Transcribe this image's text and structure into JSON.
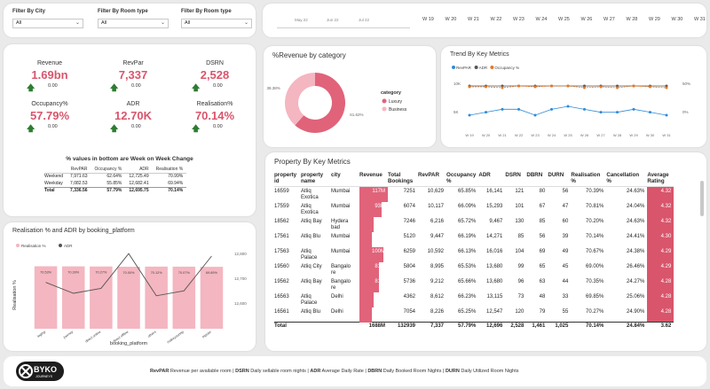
{
  "filters": [
    {
      "label": "Filter By City",
      "value": "All"
    },
    {
      "label": "Filter By Room type",
      "value": "All"
    },
    {
      "label": "Filter By Room type",
      "value": "All"
    }
  ],
  "weeks": {
    "dates": [
      "May 22",
      "Jun 22",
      "Jul 22"
    ],
    "labels": [
      "W 19",
      "W 20",
      "W 21",
      "W 22",
      "W 23",
      "W 24",
      "W 25",
      "W 26",
      "W 27",
      "W 28",
      "W 29",
      "W 30",
      "W 31"
    ]
  },
  "kpis": [
    {
      "title": "Revenue",
      "value": "1.69bn",
      "delta": "0.00"
    },
    {
      "title": "RevPar",
      "value": "7,337",
      "delta": "0.00"
    },
    {
      "title": "DSRN",
      "value": "2,528",
      "delta": "0.00"
    },
    {
      "title": "Occupancy%",
      "value": "57.79%",
      "delta": "0.00"
    },
    {
      "title": "ADR",
      "value": "12.70K",
      "delta": "0.00"
    },
    {
      "title": "Realisation%",
      "value": "70.14%",
      "delta": "0.00"
    }
  ],
  "wow": {
    "title": "% values in bottom are Week on Week Change",
    "headers": [
      "",
      "RevPAR",
      "Occupancy %",
      "ADR",
      "Realisation %"
    ],
    "rows": [
      [
        "Weekend",
        "7,971.63",
        "62.64%",
        "12,725.49",
        "70.99%"
      ],
      [
        "Weekday",
        "7,082.53",
        "55.85%",
        "12,682.41",
        "69.94%"
      ],
      [
        "Total",
        "7,336.56",
        "57.79%",
        "12,695.75",
        "70.14%"
      ]
    ]
  },
  "donut_title": "%Revenue by category",
  "trend_title": "Trend By Key Metrics",
  "realis_title": "Realisation % and ADR by booking_platform",
  "prop_title": "Property By Key Metrics",
  "chart_data": [
    {
      "type": "pie",
      "title": "%Revenue by category",
      "legend_title": "category",
      "categories": [
        "Luxury",
        "Business"
      ],
      "values": [
        61.62,
        38.38
      ],
      "value_labels": [
        "61.62%",
        "38.38%"
      ],
      "colors": [
        "#e0637a",
        "#f4b6c0"
      ]
    },
    {
      "type": "line",
      "title": "Trend By Key Metrics",
      "series": [
        {
          "name": "RevPAR",
          "color": "#2e8bd8",
          "values": [
            7.0,
            7.1,
            7.2,
            7.2,
            7.0,
            7.2,
            7.3,
            7.2,
            7.1,
            7.1,
            7.2,
            7.1,
            7.0,
            7.2
          ]
        },
        {
          "name": "ADR",
          "color": "#555555",
          "values": [
            12.7,
            12.7,
            12.7,
            12.7,
            12.7,
            12.7,
            12.7,
            12.7,
            12.7,
            12.7,
            12.7,
            12.7,
            12.7,
            12.7
          ]
        },
        {
          "name": "Occupancy %",
          "color": "#e87722",
          "values": [
            58,
            58,
            57,
            59,
            58,
            59,
            59,
            57,
            58,
            57,
            59,
            58,
            57,
            58
          ]
        }
      ],
      "categories": [
        "W 19",
        "W 20",
        "W 21",
        "W 22",
        "W 23",
        "W 24",
        "W 25",
        "W 26",
        "W 27",
        "W 28",
        "W 29",
        "W 30",
        "W 31"
      ],
      "y_ticks_left": [
        "10K",
        "5K"
      ],
      "y_ticks_right": [
        "50%",
        "0%"
      ]
    },
    {
      "type": "bar",
      "title": "Realisation % and ADR by booking_platform",
      "xlabel": "booking_platform",
      "ylabel": "Realisation %",
      "categories": [
        "logtrip",
        "journey",
        "direct online",
        "direct offline",
        "others",
        "makeyourtrip",
        "tripster"
      ],
      "series": [
        {
          "name": "Realisation %",
          "color": "#f4b6c0",
          "values": [
            70.53,
            70.39,
            70.27,
            70.0,
            70.12,
            70.07,
            69.89
          ]
        },
        {
          "name": "ADR",
          "color": "#555555",
          "values": [
            12694,
            12650,
            12670,
            12810,
            12640,
            12660,
            12800
          ]
        }
      ],
      "value_labels": [
        "70.53%",
        "70.39%",
        "70.27%",
        "70.00%",
        "70.12%",
        "70.07%",
        "69.89%"
      ],
      "y2_ticks": [
        "12,800",
        "12,700",
        "12,600"
      ]
    }
  ],
  "prop_table": {
    "headers": [
      "property id",
      "property name",
      "city",
      "Revenue",
      "Total Bookings",
      "RevPAR",
      "Occupancy %",
      "ADR",
      "DSRN",
      "DBRN",
      "DURN",
      "Realisation %",
      "Cancellation %",
      "Average Rating"
    ],
    "rows": [
      [
        "16559",
        "Atliq Exotica",
        "Mumbai",
        "117M",
        "7251",
        "10,629",
        "65.85%",
        "16,141",
        "121",
        "80",
        "56",
        "70.39%",
        "24.63%",
        "4.32"
      ],
      [
        "17559",
        "Atliq Exotica",
        "Mumbai",
        "93M",
        "6074",
        "10,117",
        "66.09%",
        "15,293",
        "101",
        "67",
        "47",
        "70.81%",
        "24.04%",
        "4.32"
      ],
      [
        "18562",
        "Atliq Bay",
        "Hydera bad",
        "58M",
        "7246",
        "6,216",
        "65.72%",
        "9,467",
        "130",
        "85",
        "60",
        "70.20%",
        "24.63%",
        "4.32"
      ],
      [
        "17561",
        "Atliq Blu",
        "Mumbai",
        "53M",
        "5120",
        "9,447",
        "66.19%",
        "14,271",
        "85",
        "56",
        "39",
        "70.14%",
        "24.41%",
        "4.30"
      ],
      [
        "17563",
        "Atliq Palace",
        "Mumbai",
        "100M",
        "6259",
        "10,592",
        "66.13%",
        "16,016",
        "104",
        "69",
        "49",
        "70.67%",
        "24.38%",
        "4.29"
      ],
      [
        "19560",
        "Atliq City",
        "Bangalo re",
        "81M",
        "5804",
        "8,995",
        "65.53%",
        "13,680",
        "99",
        "65",
        "45",
        "69.00%",
        "26.46%",
        "4.29"
      ],
      [
        "19562",
        "Atliq Bay",
        "Bangalo re",
        "81M",
        "5736",
        "9,212",
        "65.66%",
        "13,680",
        "96",
        "63",
        "44",
        "70.35%",
        "24.27%",
        "4.28"
      ],
      [
        "16563",
        "Atliq Palace",
        "Delhi",
        "57M",
        "4362",
        "8,612",
        "66.23%",
        "13,115",
        "73",
        "48",
        "33",
        "69.85%",
        "25.06%",
        "4.28"
      ],
      [
        "16561",
        "Atliq Blu",
        "Delhi",
        "52M",
        "7054",
        "8,226",
        "65.25%",
        "12,547",
        "120",
        "79",
        "55",
        "70.27%",
        "24.90%",
        "4.28"
      ]
    ],
    "total": [
      "Total",
      "",
      "",
      "1688M",
      "132939",
      "7,337",
      "57.79%",
      "12,696",
      "2,528",
      "1,461",
      "1,025",
      "70.14%",
      "24.84%",
      "3.62"
    ],
    "rev_fraction": [
      1.0,
      0.79,
      0.5,
      0.45,
      0.85,
      0.69,
      0.69,
      0.49,
      0.44
    ]
  },
  "footer": {
    "logo_text": "BYKO",
    "logo_sub": "JOURNEYS",
    "items": [
      {
        "key": "RevPAR",
        "desc": "Revenue per available room"
      },
      {
        "key": "DSRN",
        "desc": "Daily sellable room nights"
      },
      {
        "key": "ADR",
        "desc": "Average Daily Rate"
      },
      {
        "key": "DBRN",
        "desc": "Daily Booked Room Nights"
      },
      {
        "key": "DURN",
        "desc": "Daily Utilized Room Nights"
      }
    ]
  }
}
